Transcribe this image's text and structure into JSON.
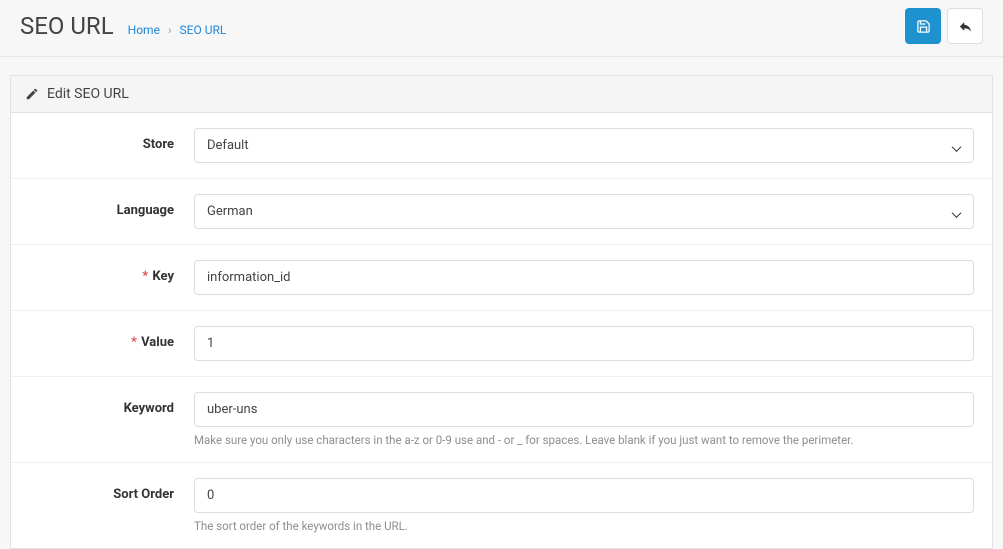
{
  "header": {
    "title": "SEO URL",
    "breadcrumb": {
      "home": "Home",
      "current": "SEO URL"
    }
  },
  "panel": {
    "title": "Edit SEO URL"
  },
  "labels": {
    "store": "Store",
    "language": "Language",
    "key": "Key",
    "value": "Value",
    "keyword": "Keyword",
    "sort_order": "Sort Order"
  },
  "fields": {
    "store_selected": "Default",
    "language_selected": "German",
    "key_value": "information_id",
    "value_value": "1",
    "keyword_value": "uber-uns",
    "sort_order_value": "0"
  },
  "help": {
    "keyword": "Make sure you only use characters in the a-z or 0-9 use and - or _ for spaces. Leave blank if you just want to remove the perimeter.",
    "sort_order": "The sort order of the keywords in the URL."
  }
}
